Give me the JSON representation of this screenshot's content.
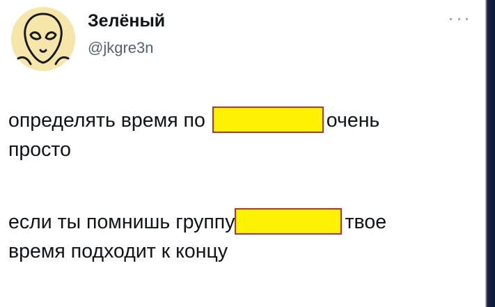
{
  "author": {
    "display_name": "Зелёный",
    "handle": "@jkgre3n",
    "avatar_icon": "alien-head-icon",
    "avatar_color": "#f6e6a9"
  },
  "more_icon": "more-horizontal-icon",
  "tweet": {
    "paragraph1": {
      "before_redaction": "определять время по",
      "after_redaction": "очень",
      "line2": "просто"
    },
    "paragraph2": {
      "before_redaction": "если ты помнишь группу",
      "after_redaction": "твое",
      "line2": "время подходит к концу"
    },
    "redaction_color": "#fff200",
    "redaction_border": "#c03030"
  }
}
